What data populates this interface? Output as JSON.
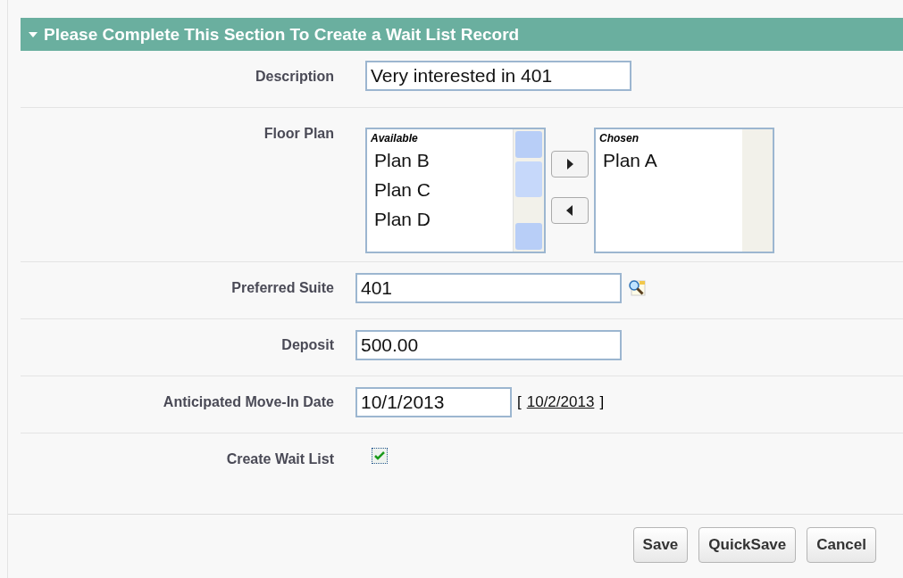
{
  "section": {
    "title": "Please Complete This Section To Create a Wait List Record",
    "expanded": true
  },
  "fields": [
    {
      "kind": "text",
      "label": "Description",
      "value": "Very interested in 401"
    },
    {
      "kind": "multiselect",
      "label": "Floor Plan",
      "available_label": "Available",
      "available": [
        "Plan B",
        "Plan C",
        "Plan D"
      ],
      "chosen_label": "Chosen",
      "chosen": [
        "Plan A"
      ]
    },
    {
      "kind": "lookup",
      "label": "Preferred Suite",
      "value": "401"
    },
    {
      "kind": "text",
      "label": "Deposit",
      "value": "500.00"
    },
    {
      "kind": "date",
      "label": "Anticipated Move-In Date",
      "value": "10/1/2013",
      "open_bracket": "[",
      "today_link": "10/2/2013",
      "close_bracket": "]"
    },
    {
      "kind": "checkbox",
      "label": "Create Wait List",
      "checked": true
    }
  ],
  "buttons": [
    "Save",
    "QuickSave",
    "Cancel"
  ]
}
